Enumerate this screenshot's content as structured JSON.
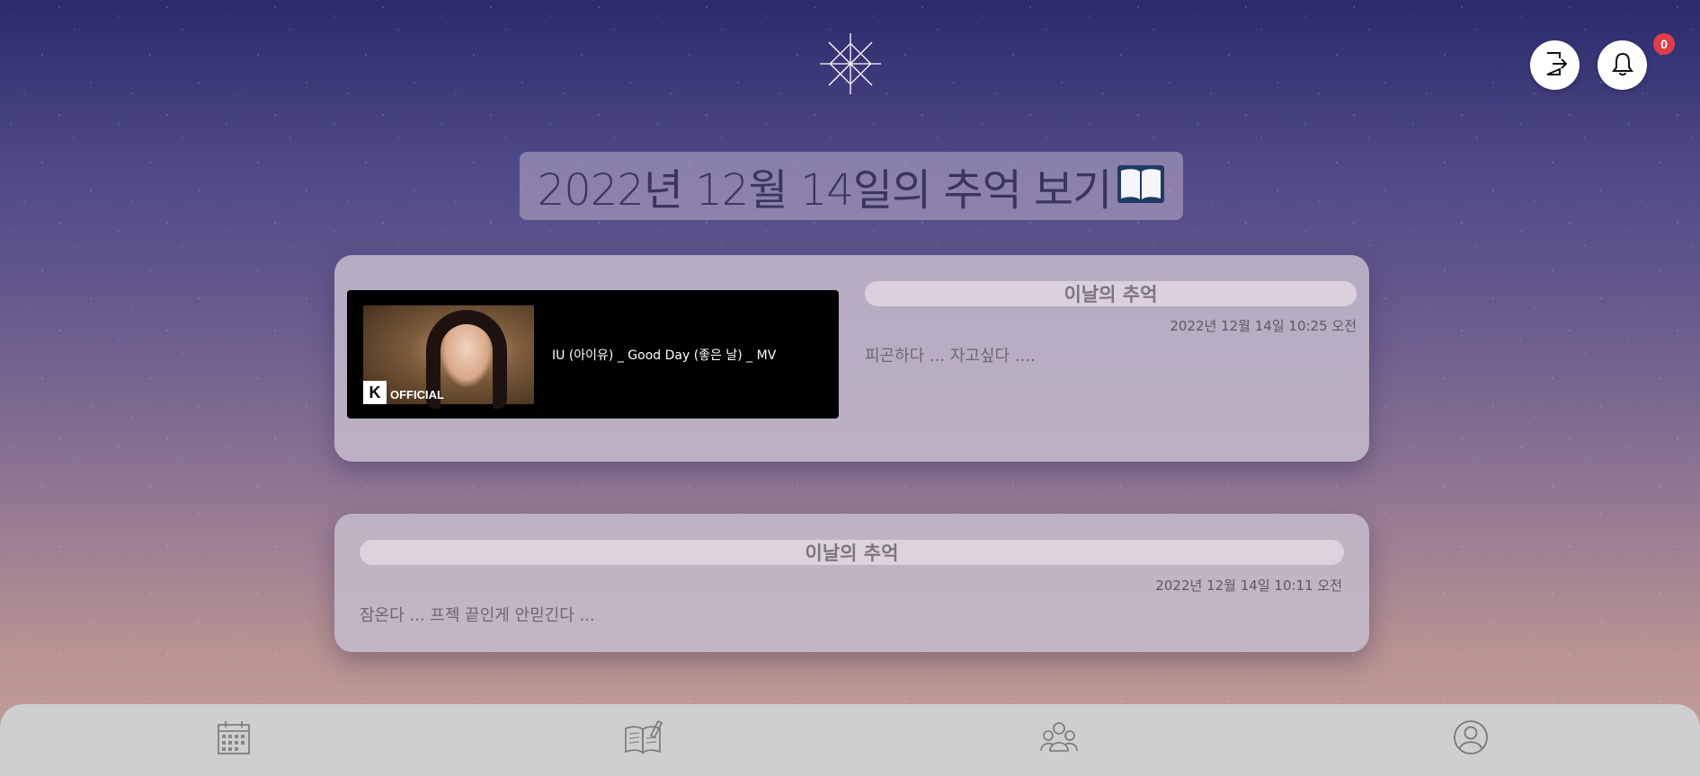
{
  "header": {
    "logo_icon": "logo-star-icon",
    "logout_icon": "logout-icon",
    "bell_icon": "bell-icon",
    "notification_count": "0",
    "badge_color": "#e03c4a"
  },
  "page": {
    "title": "2022년 12월 14일의 추억 보기",
    "title_icon": "open-book-icon"
  },
  "memories": [
    {
      "has_video": true,
      "video_title": "IU (아이유) _ Good Day (좋은 날) _ MV",
      "video_brand_letter": "K",
      "video_brand_label": "OFFICIAL",
      "heading": "이날의 추억",
      "date": "2022년 12월 14일 10:25 오전",
      "text": "피곤하다 ... 자고싶다 ...."
    },
    {
      "has_video": false,
      "heading": "이날의 추억",
      "date": "2022년 12월 14일 10:11 오전",
      "text": "잠온다 ... 프젝 끝인게 안믿긴다 ..."
    }
  ],
  "bottom_nav": [
    {
      "icon": "calendar-icon"
    },
    {
      "icon": "diary-icon"
    },
    {
      "icon": "friends-icon"
    },
    {
      "icon": "profile-icon"
    }
  ]
}
